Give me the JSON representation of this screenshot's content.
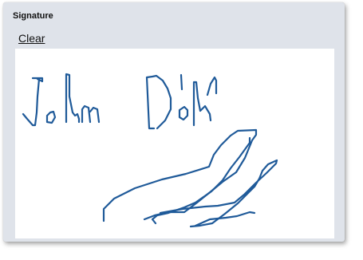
{
  "panel": {
    "title": "Signature",
    "clear_label": "Clear"
  },
  "signature": {
    "ink_color": "#1f5a99",
    "background_color": "#ffffff"
  },
  "colors": {
    "panel_background": "#dfe3ea",
    "text": "#111111"
  }
}
